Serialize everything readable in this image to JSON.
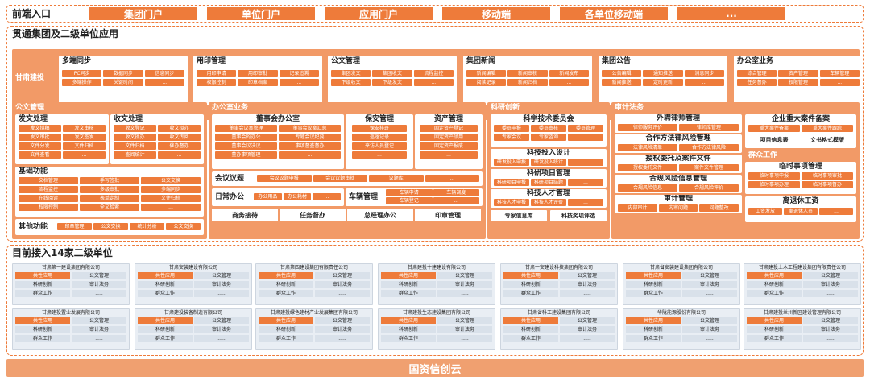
{
  "frontend": {
    "title": "前端入口",
    "items": [
      "集团门户",
      "单位门户",
      "应用门户",
      "移动端",
      "各单位移动端",
      "..."
    ]
  },
  "apps": {
    "title": "贯通集团及二级单位应用",
    "group": {
      "label": "甘肃建投",
      "boxes": [
        {
          "title": "多端同步",
          "tags": [
            "PC同步",
            "数据同步",
            "信息同步",
            "多端操作",
            "关键时间",
            "..."
          ]
        },
        {
          "title": "用印管理",
          "tags": [
            "用印申请",
            "用印审批",
            "记录追溯",
            "权限控制",
            "印章档案",
            "..."
          ]
        },
        {
          "title": "公文管理",
          "tags": [
            "集团发文",
            "集团收文",
            "流程监控",
            "下级收文",
            "下级发文",
            "..."
          ]
        },
        {
          "title": "集团新闻",
          "tags": [
            "新闻编辑",
            "新闻审核",
            "新闻发布",
            "阅读记录",
            "新闻归档",
            "..."
          ]
        },
        {
          "title": "集团公告",
          "tags": [
            "公告编辑",
            "通知推送",
            "消息同步",
            "新闻推送",
            "定时更新",
            "..."
          ]
        },
        {
          "title": "办公室业务",
          "tags": [
            "综合管理",
            "资产管理",
            "车辆管理",
            "任务督办",
            "权限管理",
            "..."
          ]
        }
      ]
    },
    "doc": {
      "title": "公文管理",
      "fawen": {
        "title": "发文处理",
        "tags": [
          "发文拟稿",
          "发文审核",
          "发文审批",
          "发文签发",
          "文件分发",
          "文件归档",
          "文件查看",
          "..."
        ]
      },
      "shouwen": {
        "title": "收文处理",
        "tags": [
          "收文登记",
          "收文拟办",
          "收文批办",
          "收文传阅",
          "文件归档",
          "催办督办",
          "查阅统计",
          "..."
        ]
      },
      "basic": {
        "title": "基础功能",
        "tags": [
          "文档管理",
          "手写签批",
          "公文交换",
          "流程监控",
          "多级审批",
          "多端同步",
          "在线阅读",
          "表单定制",
          "文件归档",
          "权限控制",
          "全文检索",
          "..."
        ]
      },
      "other": {
        "title": "其他功能",
        "tags": [
          "印章管理",
          "公文交换",
          "统计分析",
          "公文交换"
        ]
      }
    },
    "office": {
      "title": "办公室业务",
      "board": {
        "title": "董事会办公室",
        "tags": [
          "董事会议案管理",
          "董事会议案汇总",
          "董事会的办公",
          "专题会议纪要",
          "董事会议决议",
          "事项督查督办",
          "董办事项管理",
          "..."
        ]
      },
      "security": {
        "title": "保安管理",
        "tags": [
          "保安排班",
          "巡逻记录",
          "来访人员登记",
          "..."
        ]
      },
      "asset": {
        "title": "资产管理",
        "tags": [
          "固定资产登记",
          "固定资产领用",
          "固定资产报废",
          "..."
        ]
      },
      "meeting": {
        "title": "会议议题",
        "tags": [
          "会议议题申报",
          "会议议题审批",
          "议题库",
          "..."
        ]
      },
      "daily": {
        "title": "日常办公",
        "tags": [
          "办公用品",
          "办公耗材",
          "..."
        ]
      },
      "vehicle": {
        "title": "车辆管理",
        "tags": [
          "车辆申请",
          "车辆调度",
          "车辆登记",
          "..."
        ]
      },
      "bottom": [
        "商务接待",
        "任务督办",
        "总经理办公",
        "印章管理"
      ]
    },
    "research": {
      "title": "科研创新",
      "committee": {
        "title": "科学技术委员会",
        "tags": [
          "委员申报",
          "委员审核",
          "委员管理",
          "专家会议",
          "专家咨询",
          "..."
        ]
      },
      "invest": {
        "title": "科技投入设计",
        "tags": [
          "研发投入申报",
          "研发投入统计",
          "..."
        ]
      },
      "project": {
        "title": "科研项目管理",
        "tags": [
          "科研项目申报",
          "科研项目结题",
          "..."
        ]
      },
      "talent": {
        "title": "科技人才管理",
        "tags": [
          "科技人才申报",
          "科技人才评价",
          "..."
        ]
      },
      "bottom": [
        "专家信息库",
        "科技奖项评选"
      ]
    },
    "audit": {
      "title": "审计法务",
      "lawyer": {
        "title": "外聘律师管理",
        "tags": [
          "律师服务评价",
          "律师库管理",
          "..."
        ]
      },
      "contract": {
        "title": "合作方法律风险管理",
        "tags": [
          "法律风险清单",
          "合作方法律风险",
          "..."
        ]
      },
      "auth": {
        "title": "授权委托及案件文件",
        "tags": [
          "授权委托文件",
          "案件文件管理",
          "..."
        ]
      },
      "compliance": {
        "title": "合规风险信息管理",
        "tags": [
          "合规风险信息",
          "合规风险评价",
          "..."
        ]
      },
      "auditmgmt": {
        "title": "审计管理",
        "tags": [
          "内部审计",
          "内审问题",
          "问题整改"
        ]
      },
      "case": {
        "title": "企业重大案件备案",
        "tags": [
          "重大案件备案",
          "重大案件跟踪"
        ],
        "bottom": [
          "项目信息表",
          "文书格式模版"
        ]
      },
      "mass": {
        "title": "群众工作",
        "temp": {
          "title": "临时事项管理",
          "tags": [
            "临时事项申报",
            "临时事项审批",
            "临时事项办理",
            "临时事项督办"
          ]
        },
        "retire": {
          "title": "离退休工资",
          "tags": [
            "工资发放",
            "离退休人员",
            "..."
          ]
        }
      }
    }
  },
  "units": {
    "title": "目前接入14家二级单位",
    "cells": [
      "共性应用",
      "公文管理",
      "科研创新",
      "审计法务",
      "群众工作",
      "....."
    ],
    "row1": [
      "甘肃第一建设集团有限公司",
      "甘肃安装建设有限公司",
      "甘肃第四建设集团有限责任公司",
      "甘肃建投十建建设有限公司",
      "甘肃一安建设科技集团有限公司",
      "甘肃省安装建设集团有限公司",
      "甘肃建投土木工程建设集团有限责任公司"
    ],
    "row2": [
      "甘肃建投置业发展有限公司",
      "甘肃建投装备制造有限公司",
      "甘肃建投绿色建材产业发展集团有限公司",
      "甘肃建投生态建设集团有限公司",
      "甘肃省科工建设集团有限公司",
      "华陇能源股份有限公司",
      "甘肃建投兰州新区建设管理有限公司"
    ]
  },
  "footer": {
    "label": "国资信创云"
  }
}
